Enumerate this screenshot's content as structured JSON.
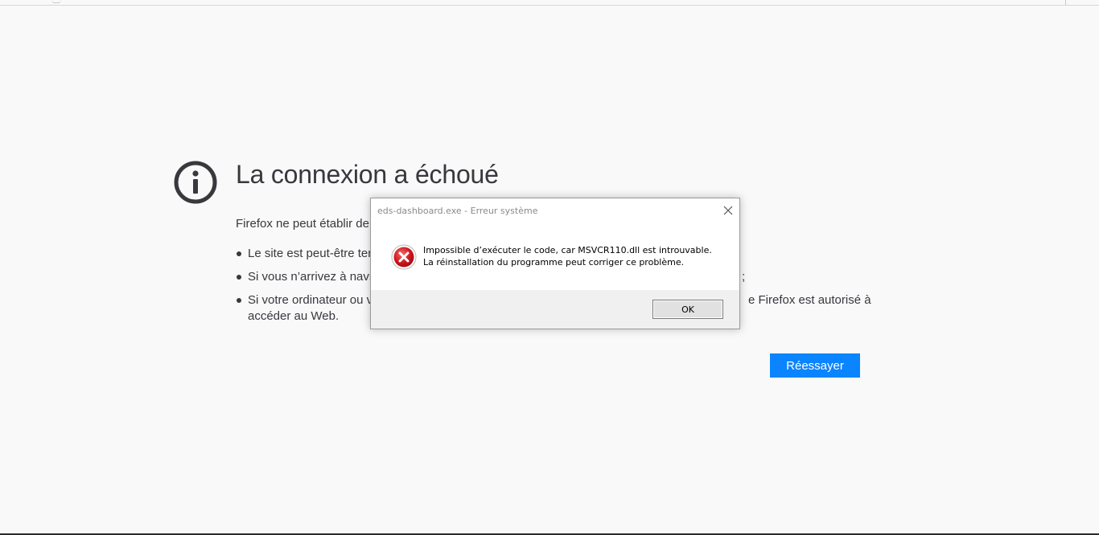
{
  "error_page": {
    "title": "La connexion a échoué",
    "intro": "Firefox ne peut établir de",
    "bullets": [
      {
        "text": "Le site est peut-être ter"
      },
      {
        "text": "Si vous n’arrivez à navig",
        "tail": ";"
      },
      {
        "text": "Si votre ordinateur ou v",
        "tail": "e Firefox est autorisé à",
        "line2": "accéder au Web."
      }
    ],
    "retry_label": "Réessayer",
    "colors": {
      "accent": "#0a84ff",
      "text": "#38383d",
      "background": "#f9f9fa"
    },
    "icon": "info-circle-icon"
  },
  "dialog": {
    "title": "eds-dashboard.exe - Erreur système",
    "message": "Impossible d’exécuter le code, car MSVCR110.dll est introuvable. La réinstallation du programme peut corriger ce problème.",
    "ok_label": "OK",
    "icon": "error-x-icon",
    "close_icon": "close-icon",
    "colors": {
      "error_red": "#d0161a",
      "footer": "#f0f0f0"
    }
  }
}
